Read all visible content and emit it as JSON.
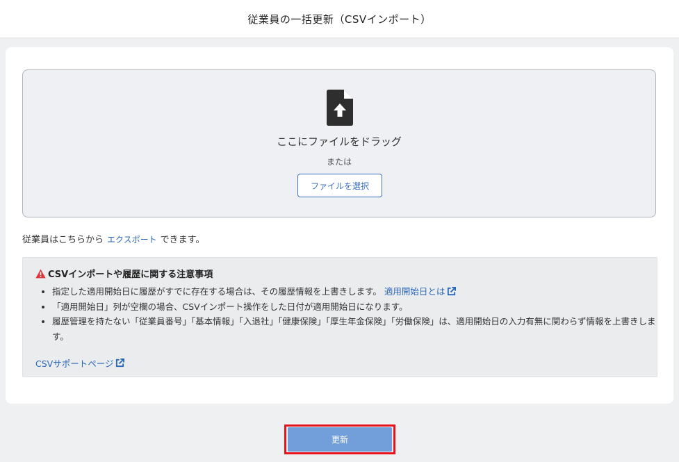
{
  "header": {
    "title": "従業員の一括更新（CSVインポート）"
  },
  "dropzone": {
    "drag_text": "ここにファイルをドラッグ",
    "or_text": "または",
    "select_button_label": "ファイルを選択"
  },
  "export": {
    "prefix": "従業員はこちらから",
    "link_label": "エクスポート",
    "suffix": "できます。"
  },
  "notice": {
    "title": "CSVインポートや履歴に関する注意事項",
    "items": [
      {
        "text": "指定した適用開始日に履歴がすでに存在する場合は、その履歴情報を上書きします。",
        "link": "適用開始日とは"
      },
      {
        "text": "「適用開始日」列が空欄の場合、CSVインポート操作をした日付が適用開始日になります。"
      },
      {
        "text": "履歴管理を持たない「従業員番号」「基本情報」「入退社」「健康保険」「厚生年金保険」「労働保険」は、適用開始日の入力有無に関わらず情報を上書きします。"
      }
    ],
    "support_link": "CSVサポートページ"
  },
  "footer": {
    "submit_label": "更新"
  },
  "colors": {
    "accent": "#3a6ec2",
    "link": "#2a68b8",
    "submit_button": "#729fd9",
    "highlight_border": "#e8131d",
    "warning": "#e0363b"
  },
  "icons": {
    "upload": "file-upload-icon",
    "warning": "warning-icon",
    "external_link": "external-link-icon"
  }
}
